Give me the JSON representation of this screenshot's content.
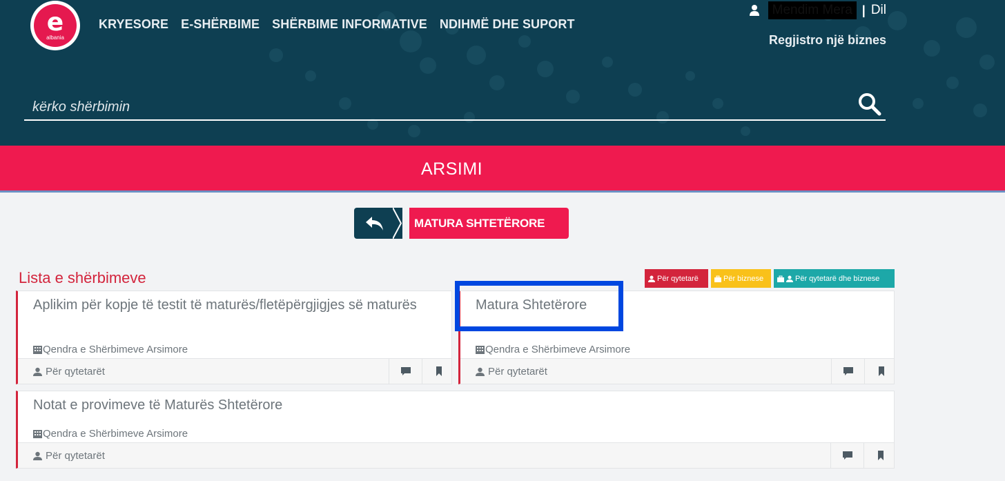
{
  "header": {
    "logo": {
      "letter": "e",
      "sub": "albania"
    },
    "nav": [
      "KRYESORE",
      "E-SHËRBIME",
      "SHËRBIME INFORMATIVE",
      "NDIHMË DHE SUPORT"
    ],
    "user": {
      "name": "Mendim Mera",
      "separator": "|",
      "logout": "Dil"
    },
    "register_business": "Regjistro një biznes",
    "search": {
      "placeholder": "kërko shërbimin",
      "value": ""
    }
  },
  "category": {
    "title": "ARSIMI"
  },
  "breadcrumb": {
    "current": "MATURA SHTETËRORE"
  },
  "list": {
    "title": "Lista e shërbimeve",
    "legend": {
      "citizens": "Për qytetarë",
      "business": "Për biznese",
      "both": "Për qytetarë dhe biznese"
    },
    "items": [
      {
        "title": "Aplikim për kopje të testit të maturës/fletëpërgjigjes së maturës",
        "institution": "Qendra e Shërbimeve Arsimore",
        "audience": "Për qytetarët"
      },
      {
        "title": "Matura Shtetërore",
        "institution": "Qendra e Shërbimeve Arsimore",
        "audience": "Për qytetarët"
      },
      {
        "title": "Notat e provimeve të Maturës Shtetërore",
        "institution": "Qendra e Shërbimeve Arsimore",
        "audience": "Për qytetarët"
      }
    ]
  },
  "colors": {
    "header_bg": "#0e3f52",
    "accent_red": "#ef1a4f",
    "list_red": "#d3243c",
    "business_yellow": "#f9c11a",
    "both_teal": "#1da8a8",
    "highlight_blue": "#0047e0"
  }
}
